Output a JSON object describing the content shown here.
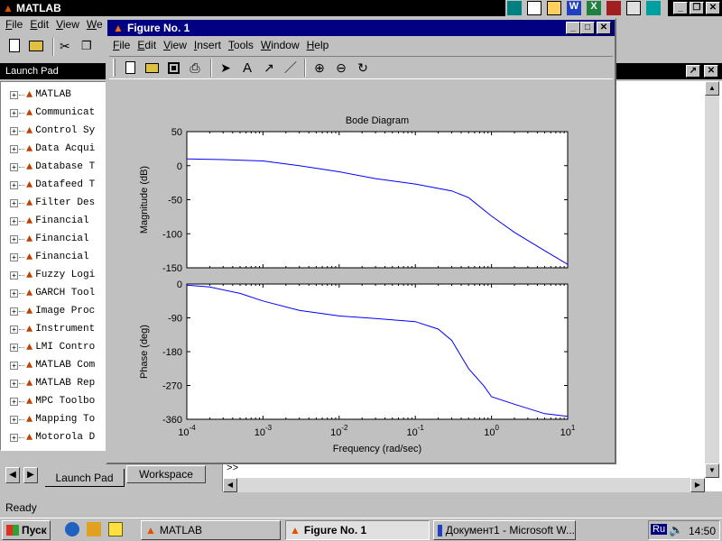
{
  "matlab": {
    "title": "MATLAB",
    "menu": [
      "File",
      "Edit",
      "View",
      "We"
    ],
    "launch_pad_title": "Launch Pad",
    "tree_items": [
      "MATLAB",
      "Communicat",
      "Control Sy",
      "Data Acqui",
      "Database T",
      "Datafeed T",
      "Filter Des",
      "Financial",
      "Financial",
      "Financial",
      "Fuzzy Logi",
      "GARCH Tool",
      "Image Proc",
      "Instrument",
      "LMI Contro",
      "MATLAB Com",
      "MATLAB Rep",
      "MPC Toolbo",
      "Mapping To",
      "Motorola D"
    ],
    "tabs": [
      "Launch Pad",
      "Workspace"
    ],
    "prompt": ">>",
    "status": "Ready"
  },
  "figure": {
    "title": "Figure No. 1",
    "menu": [
      "File",
      "Edit",
      "View",
      "Insert",
      "Tools",
      "Window",
      "Help"
    ]
  },
  "chart_data": [
    {
      "type": "line",
      "title": "Bode Diagram",
      "ylabel": "Magnitude (dB)",
      "xscale": "log",
      "xlim": [
        0.0001,
        10
      ],
      "ylim": [
        -150,
        50
      ],
      "yticks": [
        50,
        0,
        -50,
        -100,
        -150
      ],
      "x": [
        0.0001,
        0.0003,
        0.001,
        0.003,
        0.01,
        0.03,
        0.1,
        0.3,
        0.5,
        1,
        2,
        5,
        10
      ],
      "values": [
        10,
        9,
        7,
        0,
        -9,
        -19,
        -27,
        -37,
        -47,
        -74,
        -98,
        -125,
        -145
      ],
      "color": "#0000ff"
    },
    {
      "type": "line",
      "xlabel": "Frequency (rad/sec)",
      "ylabel": "Phase (deg)",
      "xscale": "log",
      "xlim": [
        0.0001,
        10
      ],
      "ylim": [
        -360,
        0
      ],
      "yticks": [
        0,
        -90,
        -180,
        -270,
        -360
      ],
      "xticks": [
        "10",
        "10",
        "10",
        "10",
        "10",
        "10"
      ],
      "xtick_exponents": [
        "-4",
        "-3",
        "-2",
        "-1",
        "0",
        "1"
      ],
      "x": [
        0.0001,
        0.0002,
        0.0005,
        0.001,
        0.003,
        0.01,
        0.03,
        0.1,
        0.2,
        0.3,
        0.5,
        0.8,
        1,
        2,
        5,
        10
      ],
      "values": [
        -3,
        -8,
        -25,
        -45,
        -70,
        -85,
        -92,
        -100,
        -120,
        -150,
        -225,
        -272,
        -300,
        -320,
        -345,
        -352
      ],
      "color": "#0000ff"
    }
  ],
  "taskbar": {
    "start": "Пуск",
    "buttons": [
      "MATLAB",
      "Figure No. 1",
      "Документ1 - Microsoft W..."
    ],
    "lang": "Ru",
    "clock": "14:50"
  }
}
